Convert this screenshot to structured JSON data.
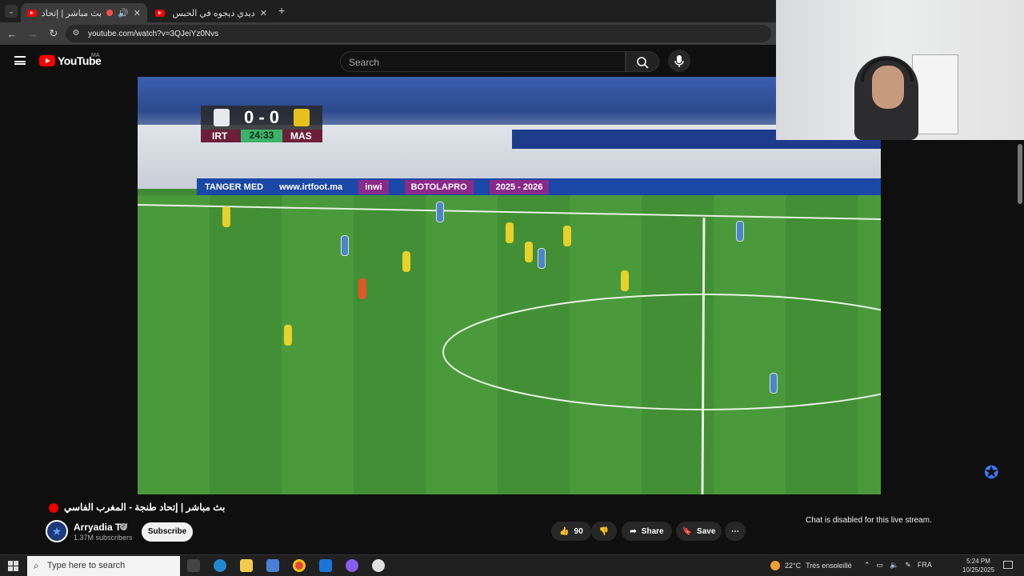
{
  "browser": {
    "tabs": [
      {
        "title": "بث مباشر | إتحاد طنجة"
      },
      {
        "title": "ديدي ديجوه في الحبس | بنت كاتر"
      }
    ],
    "url": "youtube.com/watch?v=3QJeiYz0Nvs"
  },
  "youtube": {
    "logo": "YouTube",
    "country": "MA",
    "search_placeholder": "Search"
  },
  "scoreboard": {
    "score": "0 - 0",
    "home": "IRT",
    "away": "MAS",
    "clock": "24:33",
    "colors": {
      "clock": "#3bb36a",
      "bar": "#6d1f3a"
    }
  },
  "video_boards": {
    "sponsor1": "TANGER MED",
    "sponsor2": "www.irtfoot.ma",
    "sponsor3": "inwi",
    "sponsor4": "BOTOLAPRO",
    "season": "2025 - 2026"
  },
  "video_info": {
    "title": "بث مباشر | إتحاد طنجة - المغرب الفاسي",
    "channel": "Arryadia TV",
    "subscribers": "1.37M subscribers",
    "subscribe_label": "Subscribe",
    "likes": "90",
    "share_label": "Share",
    "save_label": "Save",
    "chat_disabled": "Chat is disabled for this live stream."
  },
  "taskbar": {
    "search_placeholder": "Type here to search",
    "temperature": "22°C",
    "weather_text": "Très ensoleillé",
    "lang": "FRA",
    "time": "5:24 PM",
    "date": "10/25/2025"
  }
}
